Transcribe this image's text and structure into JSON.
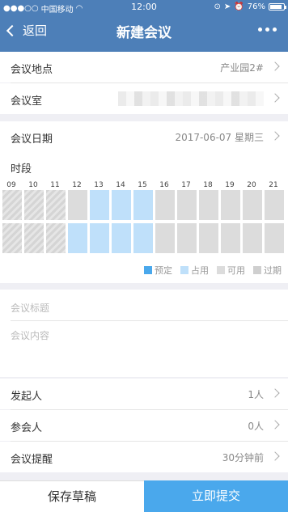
{
  "statusbar": {
    "carrier": "中国移动",
    "time": "12:00",
    "battery": "76%"
  },
  "navbar": {
    "back_label": "返回",
    "title": "新建会议"
  },
  "location": {
    "label": "会议地点",
    "value": "产业园2#"
  },
  "room": {
    "label": "会议室"
  },
  "date": {
    "label": "会议日期",
    "value": "2017-06-07 星期三"
  },
  "timeslot": {
    "label": "时段",
    "hours": [
      "09",
      "10",
      "11",
      "12",
      "13",
      "14",
      "15",
      "16",
      "17",
      "18",
      "19",
      "20",
      "21"
    ],
    "rows": [
      [
        "past",
        "past",
        "past",
        "past",
        "past",
        "past",
        "free",
        "free",
        "occupied",
        "occupied",
        "occupied",
        "occupied",
        "occupied",
        "occupied",
        "free",
        "free",
        "free",
        "free",
        "free",
        "free",
        "free",
        "free",
        "free",
        "free",
        "free",
        "free"
      ],
      [
        "past",
        "past",
        "past",
        "past",
        "past",
        "past",
        "occupied",
        "occupied",
        "occupied",
        "occupied",
        "occupied",
        "occupied",
        "occupied",
        "occupied",
        "free",
        "free",
        "free",
        "free",
        "free",
        "free",
        "free",
        "free",
        "free",
        "free",
        "free",
        "free"
      ]
    ],
    "legend": [
      {
        "label": "预定",
        "color": "#4aa8ec"
      },
      {
        "label": "占用",
        "color": "#bfe0fa"
      },
      {
        "label": "可用",
        "color": "#dcdcdc"
      },
      {
        "label": "过期",
        "color": "#cfcfcf"
      }
    ]
  },
  "title_placeholder": "会议标题",
  "content_placeholder": "会议内容",
  "initiator": {
    "label": "发起人",
    "value": "1人"
  },
  "participants": {
    "label": "参会人",
    "value": "0人"
  },
  "reminder": {
    "label": "会议提醒",
    "value": "30分钟前"
  },
  "footer": {
    "save_label": "保存草稿",
    "submit_label": "立即提交"
  }
}
